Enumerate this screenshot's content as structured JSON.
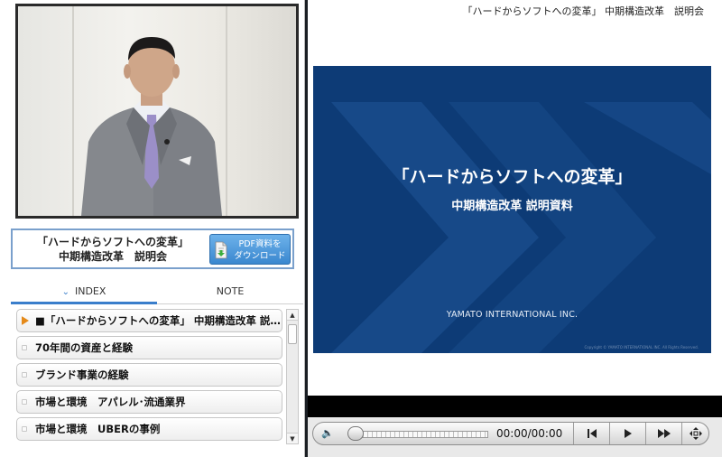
{
  "header": {
    "title": "「ハードからソフトへの変革」 中期構造改革　説明会"
  },
  "lecture": {
    "title_line1": "「ハードからソフトへの変革」",
    "title_line2": "中期構造改革　説明会",
    "pdf_button_label": "PDF資料を\nダウンロード"
  },
  "tabs": {
    "index_label": "INDEX",
    "note_label": "NOTE",
    "active": "INDEX"
  },
  "index_items": [
    {
      "label": "■「ハードからソフトへの変革」 中期構造改革 説明会",
      "active": true
    },
    {
      "label": "70年間の資産と経験",
      "active": false
    },
    {
      "label": "ブランド事業の経験",
      "active": false
    },
    {
      "label": "市場と環境　アパレル･流通業界",
      "active": false
    },
    {
      "label": "市場と環境　UBERの事例",
      "active": false
    }
  ],
  "slide": {
    "title": "「ハードからソフトへの変革」",
    "subtitle": "中期構造改革 説明資料",
    "company": "YAMATO INTERNATIONAL INC.",
    "copyright": "Copyright © YAMATO INTERNATIONAL INC. All Rights Reserved.",
    "background_color": "#0d3b76"
  },
  "player": {
    "time": "00:00/00:00",
    "progress": 0,
    "icons": [
      "volume-icon",
      "previous-icon",
      "play-icon",
      "next-icon",
      "fullscreen-icon"
    ]
  },
  "colors": {
    "accent": "#3a7ecb",
    "active_marker": "#e58a1a",
    "pdf_button": "#4a97da"
  }
}
